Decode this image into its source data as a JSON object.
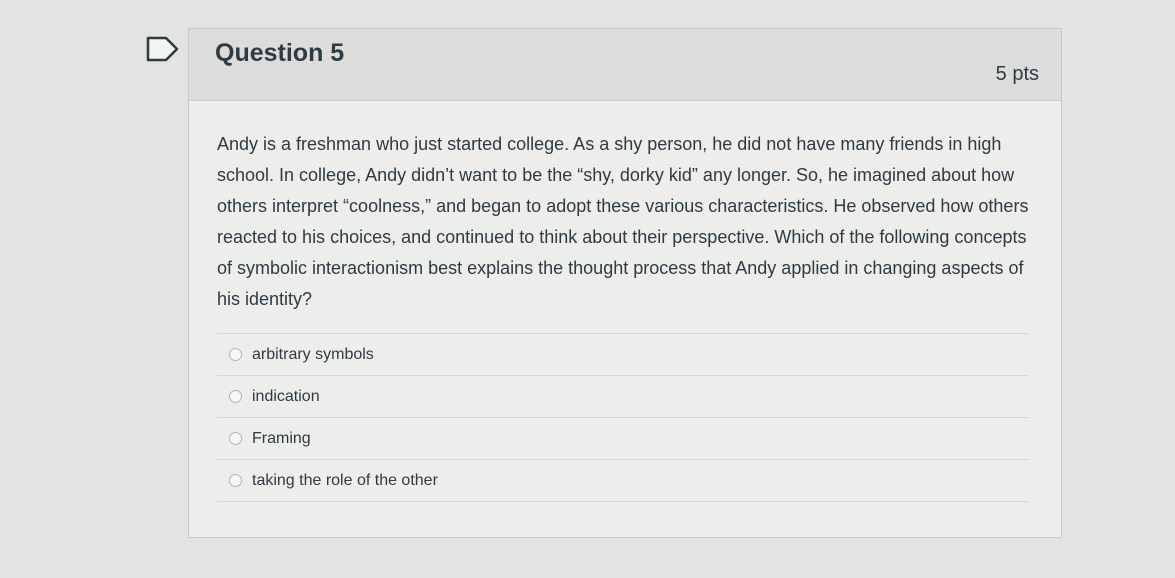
{
  "question": {
    "title": "Question 5",
    "points": "5 pts",
    "text": "Andy is a freshman who just started college. As a shy person, he did not have many friends in high school. In college, Andy didn’t want to be the “shy, dorky kid” any longer. So, he imagined about how others interpret “coolness,” and began to adopt these various characteristics. He observed how others reacted to his choices, and continued to think about their perspective. Which of the following concepts of symbolic interactionism best explains the thought process that Andy applied in changing aspects of his identity?",
    "answers": [
      {
        "label": "arbitrary symbols"
      },
      {
        "label": "indication"
      },
      {
        "label": "Framing"
      },
      {
        "label": "taking the role of the other"
      }
    ]
  },
  "icons": {
    "flag": "flag-outline-icon",
    "radio": "radio-unselected-icon"
  },
  "colors": {
    "text": "#2d3b45",
    "header_bg": "#dcdcda",
    "card_bg": "#ededeb",
    "page_bg": "#e3e3e1"
  }
}
